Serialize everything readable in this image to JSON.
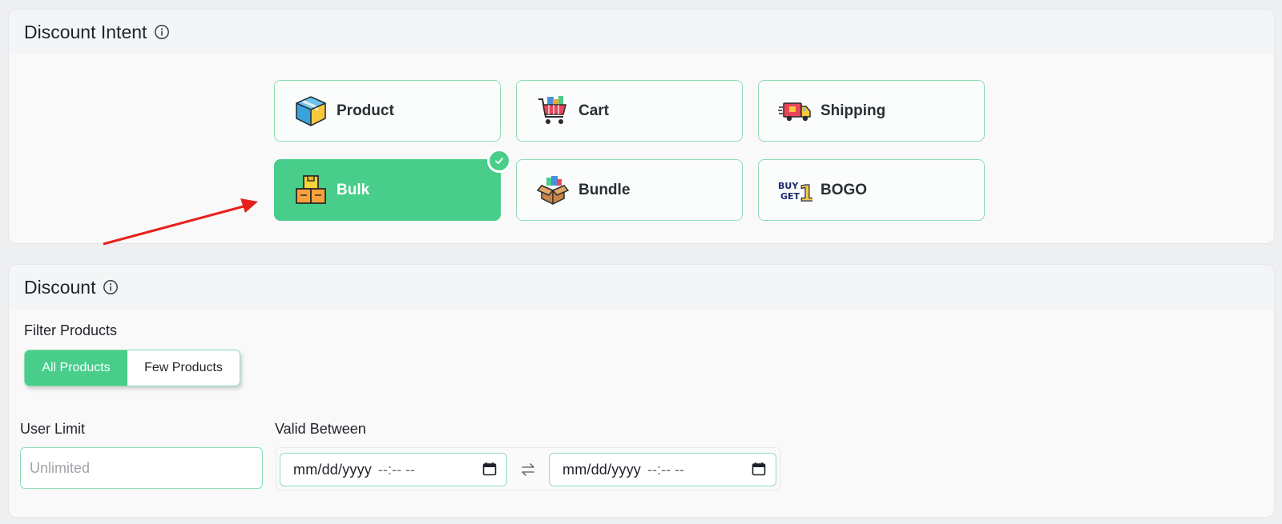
{
  "intent": {
    "title": "Discount Intent",
    "options": [
      {
        "label": "Product",
        "icon": "box-icon"
      },
      {
        "label": "Cart",
        "icon": "shopping-cart-icon"
      },
      {
        "label": "Shipping",
        "icon": "delivery-truck-icon"
      },
      {
        "label": "Bulk",
        "icon": "stacked-boxes-icon",
        "selected": true
      },
      {
        "label": "Bundle",
        "icon": "open-box-icon"
      },
      {
        "label": "BOGO",
        "icon": "buy-get-1-icon"
      }
    ],
    "bogo_icon_text": {
      "line1": "BUY",
      "line2": "GET",
      "number": "1"
    }
  },
  "discount": {
    "title": "Discount",
    "filter_products": {
      "label": "Filter Products",
      "options": [
        "All Products",
        "Few Products"
      ],
      "selected": "All Products"
    },
    "user_limit": {
      "label": "User Limit",
      "placeholder": "Unlimited",
      "value": ""
    },
    "valid_between": {
      "label": "Valid Between",
      "start": {
        "date": "mm/dd/yyyy",
        "time": "--:-- --"
      },
      "end": {
        "date": "mm/dd/yyyy",
        "time": "--:-- --"
      }
    }
  },
  "colors": {
    "accent": "#48cd8a",
    "border": "#8fdcb2",
    "annotation_arrow": "#e8201c"
  }
}
